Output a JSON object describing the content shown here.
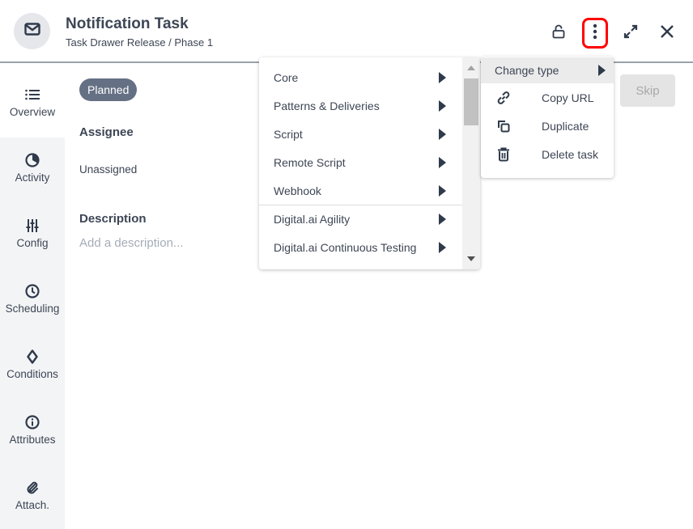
{
  "header": {
    "title": "Notification Task",
    "subtitle": "Task Drawer Release / Phase 1",
    "icon": "envelope-icon",
    "actions": [
      "lock-icon",
      "more-vertical-icon",
      "expand-icon",
      "close-icon"
    ]
  },
  "sidebar": {
    "items": [
      {
        "label": "Overview",
        "icon": "list-icon",
        "active": true
      },
      {
        "label": "Activity",
        "icon": "activity-clock-icon",
        "active": false
      },
      {
        "label": "Config",
        "icon": "sliders-icon",
        "active": false
      },
      {
        "label": "Scheduling",
        "icon": "clock-icon",
        "active": false
      },
      {
        "label": "Conditions",
        "icon": "diamond-icon",
        "active": false
      },
      {
        "label": "Attributes",
        "icon": "info-icon",
        "active": false
      },
      {
        "label": "Attach.",
        "icon": "paperclip-icon",
        "active": false
      }
    ]
  },
  "overview": {
    "status": "Planned",
    "assignee_label": "Assignee",
    "assignee_value": "Unassigned",
    "description_label": "Description",
    "description_placeholder": "Add a description...",
    "skip_label": "Skip"
  },
  "type_menu": {
    "items": [
      {
        "label": "Core"
      },
      {
        "label": "Patterns & Deliveries"
      },
      {
        "label": "Script"
      },
      {
        "label": "Remote Script"
      },
      {
        "label": "Webhook"
      },
      {
        "label": "Digital.ai Agility"
      },
      {
        "label": "Digital.ai Continuous Testing"
      }
    ]
  },
  "action_menu": {
    "change_type": "Change type",
    "items": [
      {
        "label": "Copy URL",
        "icon": "link-icon"
      },
      {
        "label": "Duplicate",
        "icon": "duplicate-icon"
      },
      {
        "label": "Delete task",
        "icon": "trash-icon"
      }
    ]
  },
  "colors": {
    "highlight": "#ff0000",
    "badge": "#667085",
    "text": "#3d4655"
  }
}
